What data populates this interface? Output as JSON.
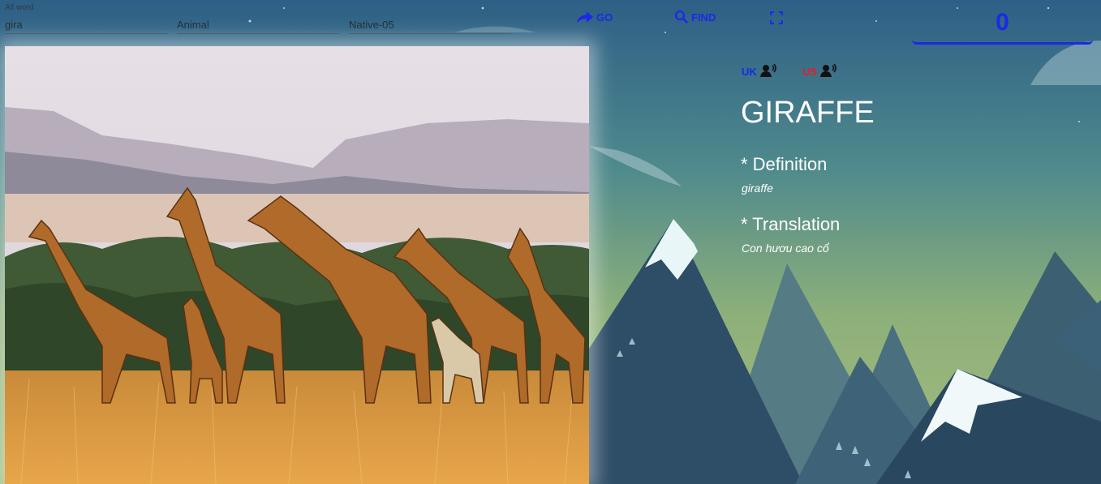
{
  "search": {
    "label": "All word",
    "value": "gira",
    "category": "Animal",
    "level": "Native-05"
  },
  "toolbar": {
    "go_label": "GO",
    "find_label": "FIND"
  },
  "score": "0",
  "pronunciation": {
    "uk_label": "UK",
    "us_label": "US",
    "uk_color": "#1a2ae6",
    "us_color": "#e0202a"
  },
  "word": {
    "title": "GIRAFFE",
    "definition_heading": "* Definition",
    "definition": "giraffe",
    "translation_heading": "* Translation",
    "translation": "Con hươu cao cổ"
  },
  "colors": {
    "accent": "#1a2ae6"
  }
}
